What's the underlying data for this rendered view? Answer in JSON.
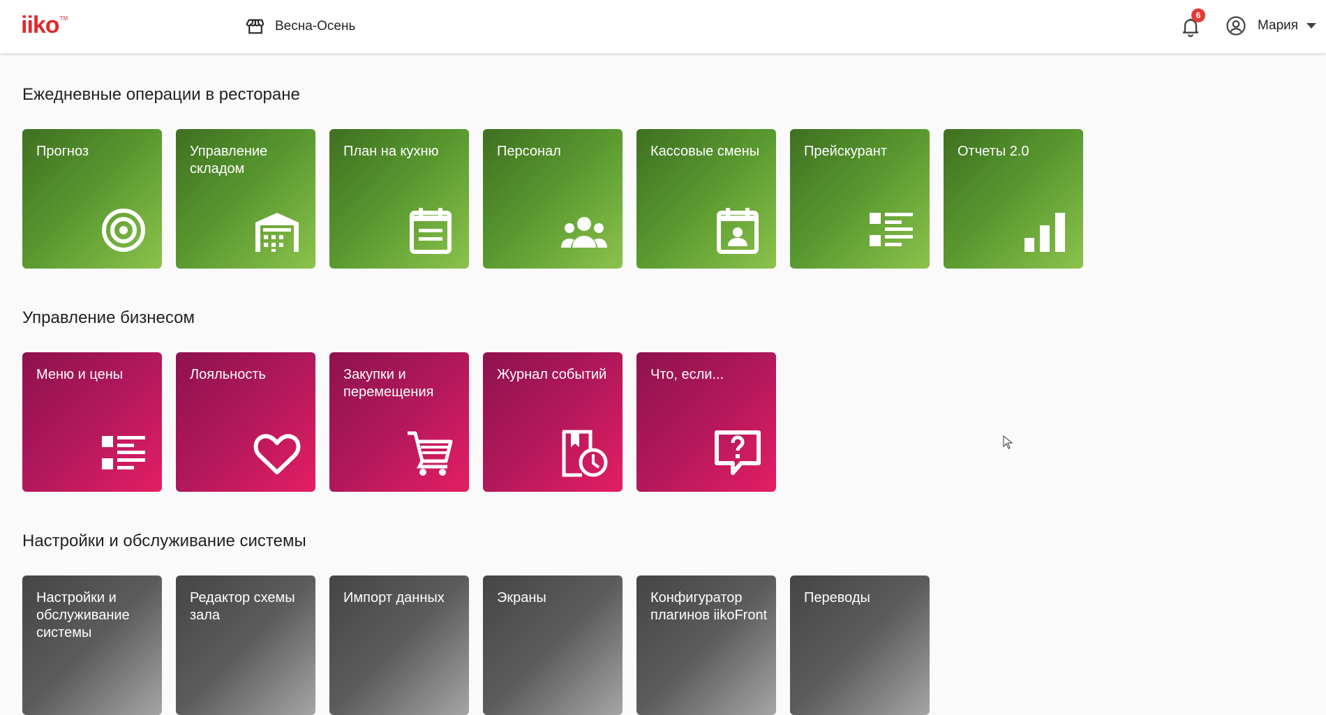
{
  "header": {
    "logo_text": "iiko",
    "logo_tm": "TM",
    "store_name": "Весна-Осень",
    "notifications_count": "6",
    "user_name": "Мария"
  },
  "colors": {
    "brand_red": "#e2282e",
    "green_tile_dark": "#3f7021",
    "green_tile_light": "#8cc24c",
    "pink_tile_dark": "#8e124e",
    "pink_tile_light": "#e51e63",
    "gray_tile_dark": "#454545",
    "gray_tile_light": "#a5a5a5",
    "badge": "#e53935"
  },
  "sections": [
    {
      "title": "Ежедневные операции в ресторане",
      "tiles": [
        {
          "label": "Прогноз",
          "icon": "target-icon"
        },
        {
          "label": "Управление складом",
          "icon": "warehouse-icon"
        },
        {
          "label": "План на кухню",
          "icon": "calendar-note-icon"
        },
        {
          "label": "Персонал",
          "icon": "people-icon"
        },
        {
          "label": "Кассовые смены",
          "icon": "calendar-person-icon"
        },
        {
          "label": "Прейскурант",
          "icon": "list-icon"
        },
        {
          "label": "Отчеты 2.0",
          "icon": "signal-bars-icon"
        }
      ]
    },
    {
      "title": "Управление бизнесом",
      "tiles": [
        {
          "label": "Меню и цены",
          "icon": "list-icon"
        },
        {
          "label": "Лояльность",
          "icon": "heart-icon"
        },
        {
          "label": "Закупки и перемещения",
          "icon": "cart-icon"
        },
        {
          "label": "Журнал событий",
          "icon": "book-clock-icon"
        },
        {
          "label": "Что, если...",
          "icon": "question-bubble-icon"
        }
      ]
    },
    {
      "title": "Настройки и обслуживание системы",
      "tiles": [
        {
          "label": "Настройки и обслуживание системы",
          "icon": ""
        },
        {
          "label": "Редактор схемы зала",
          "icon": ""
        },
        {
          "label": "Импорт данных",
          "icon": ""
        },
        {
          "label": "Экраны",
          "icon": ""
        },
        {
          "label": "Конфигуратор плагинов iikoFront",
          "icon": ""
        },
        {
          "label": "Переводы",
          "icon": ""
        }
      ]
    }
  ]
}
